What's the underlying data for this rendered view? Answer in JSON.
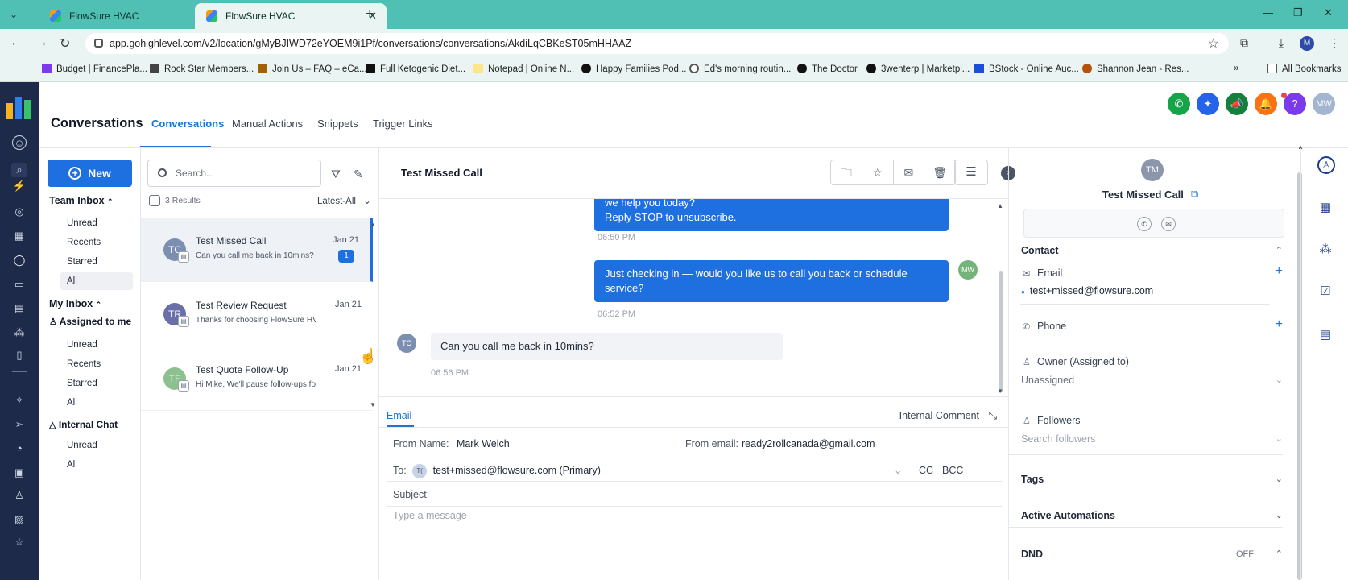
{
  "browser": {
    "tabs": [
      {
        "title": "FlowSure HVAC",
        "active": false
      },
      {
        "title": "FlowSure HVAC",
        "active": true
      }
    ],
    "url": "app.gohighlevel.com/v2/location/gMyBJIWD72eYOEM9i1Pf/conversations/conversations/AkdiLqCBKeST05mHHAAZ",
    "profile_initial": "M",
    "bookmarks": [
      "Budget | FinancePla...",
      "Rock Star Members...",
      "Join Us – FAQ – eCa...",
      "Full Ketogenic Diet...",
      "Notepad | Online N...",
      "Happy Families Pod...",
      "Ed's morning routin...",
      "The Doctor",
      "3wenterp | Marketpl...",
      "BStock - Online Auc...",
      "Shannon Jean - Res..."
    ],
    "all_bookmarks": "All Bookmarks"
  },
  "header": {
    "page_title": "Conversations",
    "tabs": [
      "Conversations",
      "Manual Actions",
      "Snippets",
      "Trigger Links"
    ],
    "user_initials": "MW"
  },
  "sidebar": {
    "new_label": "New",
    "team_inbox": "Team Inbox",
    "team_items": [
      "Unread",
      "Recents",
      "Starred",
      "All"
    ],
    "my_inbox": "My Inbox",
    "assigned_to_me": "Assigned to me",
    "my_items": [
      "Unread",
      "Recents",
      "Starred",
      "All"
    ],
    "internal_chat": "Internal Chat",
    "chat_items": [
      "Unread",
      "All"
    ]
  },
  "list": {
    "search_placeholder": "Search...",
    "results": "3 Results",
    "sort": "Latest-All",
    "conversations": [
      {
        "initials": "TC",
        "name": "Test Missed Call",
        "preview": "Can you call me back in 10mins?",
        "date": "Jan 21",
        "unread": "1"
      },
      {
        "initials": "TR",
        "name": "Test Review Request",
        "preview": "Thanks for choosing FlowSure HV",
        "date": "Jan 21",
        "unread": ""
      },
      {
        "initials": "TF",
        "name": "Test Quote Follow-Up",
        "preview": "Hi Mike, We'll pause follow-ups fo",
        "date": "Jan 21",
        "unread": ""
      }
    ]
  },
  "thread": {
    "title": "Test Missed Call",
    "messages": [
      {
        "text_line1": "we help you today?",
        "text_line2": "Reply STOP to unsubscribe.",
        "time": "06:50 PM"
      },
      {
        "text_line1": "Just checking in — would you like us to call you back or schedule",
        "text_line2": "service?",
        "time": "06:52 PM",
        "sender_initials": "MW"
      },
      {
        "text": "Can you call me back in 10mins?",
        "time": "06:56 PM",
        "sender_initials": "TC"
      }
    ]
  },
  "composer": {
    "tab": "Email",
    "internal_comment": "Internal Comment",
    "from_name_label": "From Name:",
    "from_name": "Mark Welch",
    "from_email_label": "From email:",
    "from_email": "ready2rollcanada@gmail.com",
    "to_label": "To:",
    "to_initials": "T(",
    "to_value": "test+missed@flowsure.com (Primary)",
    "cc": "CC",
    "bcc": "BCC",
    "subject_label": "Subject:",
    "message_placeholder": "Type a message"
  },
  "contact": {
    "initials": "TM",
    "name": "Test Missed Call",
    "section_contact": "Contact",
    "email_label": "Email",
    "email_value": "test+missed@flowsure.com",
    "phone_label": "Phone",
    "owner_label": "Owner (Assigned to)",
    "owner_value": "Unassigned",
    "followers_label": "Followers",
    "followers_placeholder": "Search followers",
    "tags": "Tags",
    "active_automations": "Active Automations",
    "dnd": "DND",
    "dnd_value": "OFF"
  }
}
